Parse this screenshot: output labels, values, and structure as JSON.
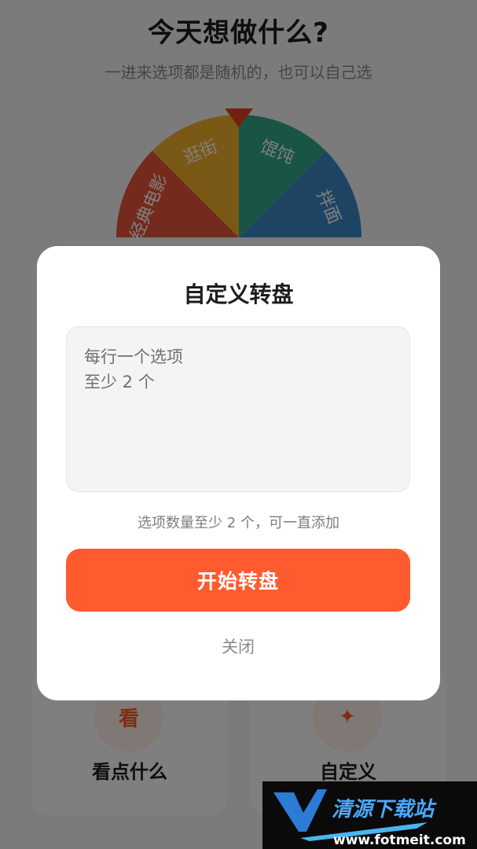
{
  "header": {
    "title": "今天想做什么?",
    "subtitle": "一进来选项都是随机的，也可以自己选"
  },
  "wheel": {
    "segments": [
      {
        "label": "逛街",
        "color": "#F5B32E"
      },
      {
        "label": "馄饨",
        "color": "#33A98A"
      },
      {
        "label": "拌面",
        "color": "#3C88C9"
      },
      {
        "label": "经典电影",
        "color": "#E8573A"
      }
    ],
    "pointer_color": "#E5431F"
  },
  "cards": [
    {
      "icon_glyph": "看",
      "label": "看点什么"
    },
    {
      "icon_glyph": "✦",
      "label": "自定义"
    }
  ],
  "dialog": {
    "title": "自定义转盘",
    "input_placeholder": "每行一个选项\n至少 2 个",
    "hint": "选项数量至少 2 个，可一直添加",
    "start_label": "开始转盘",
    "close_label": "关闭"
  },
  "watermark": {
    "title": "清源下载站",
    "url": "www.fotmeit.com"
  },
  "colors": {
    "accent": "#FF5B2E",
    "overlay": "rgba(0,0,0,0.5)"
  }
}
